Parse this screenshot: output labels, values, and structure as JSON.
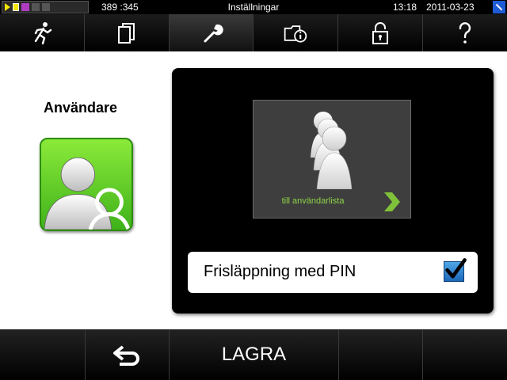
{
  "status_bar": {
    "counter": "389 :345",
    "title": "Inställningar",
    "time": "13:18",
    "date": "2011-03-23",
    "icons": [
      "play-icon",
      "card-icon",
      "magnifier-icon",
      "status-icon",
      "lock-icon"
    ]
  },
  "nav": {
    "tabs": [
      {
        "icon": "running-man-icon"
      },
      {
        "icon": "documents-icon"
      },
      {
        "icon": "wrench-icon",
        "active": true
      },
      {
        "icon": "folder-info-icon"
      },
      {
        "icon": "unlock-icon"
      },
      {
        "icon": "help-icon"
      }
    ]
  },
  "section": {
    "title": "Användare",
    "tile_icon": "users-icon"
  },
  "panel": {
    "userlist_button": {
      "label": "till användarlista",
      "icon": "users-group-icon",
      "arrow_icon": "chevron-right-icon"
    },
    "pin_release": {
      "label": "Frisläppning med PIN",
      "checked": true
    }
  },
  "bottom_bar": {
    "back_icon": "back-arrow-icon",
    "save_label": "LAGRA"
  },
  "colors": {
    "accent_green": "#5fcf23",
    "label_green": "#8ed348",
    "checkbox_blue": "#2b7fd1",
    "bar_black": "#000000"
  }
}
